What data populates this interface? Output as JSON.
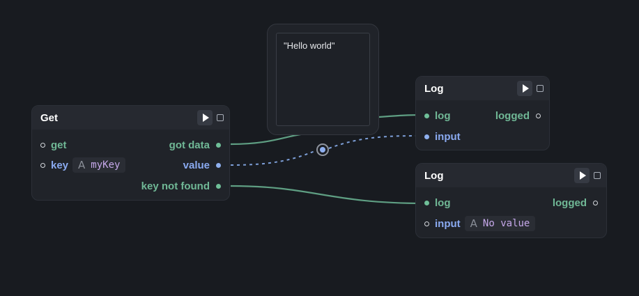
{
  "nodes": {
    "get": {
      "title": "Get",
      "inputs": {
        "get_label": "get",
        "key_label": "key",
        "key_value": "myKey"
      },
      "outputs": {
        "got_data": "got data",
        "value": "value",
        "key_not_found": "key not found"
      }
    },
    "text": {
      "content": "\"Hello world\""
    },
    "log1": {
      "title": "Log",
      "inputs": {
        "log_label": "log",
        "input_label": "input"
      },
      "outputs": {
        "logged": "logged"
      }
    },
    "log2": {
      "title": "Log",
      "inputs": {
        "log_label": "log",
        "input_label": "input",
        "input_value": "No value"
      },
      "outputs": {
        "logged": "logged"
      }
    }
  },
  "icons": {
    "run": "play-icon",
    "stop": "stop-icon",
    "string_type": "string-type-icon"
  },
  "colors": {
    "background": "#181b20",
    "node": "#202329",
    "trigger_wire": "#5f9f83",
    "data_wire": "#7d9fd8",
    "trigger_port": "#6fbf98",
    "data_port": "#8fb0ef",
    "constant_value": "#c6a8ea"
  }
}
